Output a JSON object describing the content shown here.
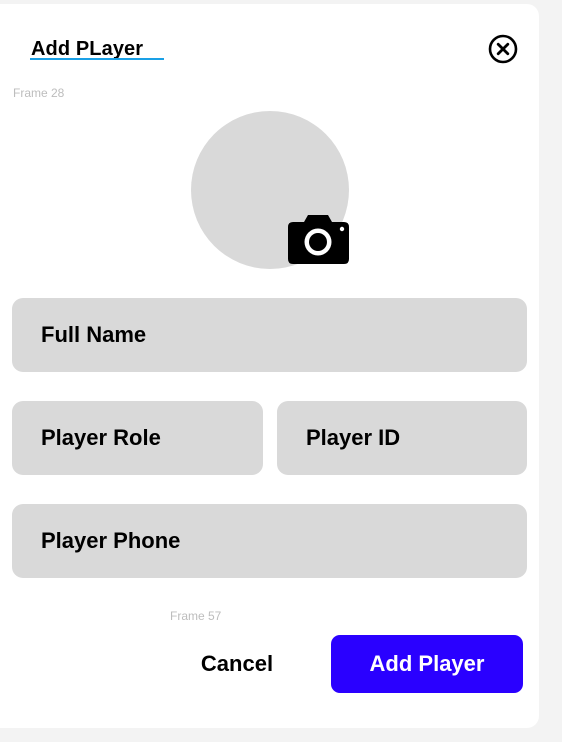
{
  "modal": {
    "title": "Add PLayer",
    "close_icon": "close-circle-icon",
    "frame_top_label": "Frame 28",
    "frame_bottom_label": "Frame 57"
  },
  "avatar": {
    "upload_icon": "camera-icon"
  },
  "fields": {
    "full_name": "Full Name",
    "player_role": "Player Role",
    "player_id": "Player ID",
    "player_phone": "Player Phone"
  },
  "actions": {
    "cancel_label": "Cancel",
    "add_label": "Add Player"
  },
  "colors": {
    "accent": "#2a00ff",
    "underline": "#1aa0e6",
    "field_bg": "#d9d9d9",
    "page_bg": "#f3f3f3"
  }
}
